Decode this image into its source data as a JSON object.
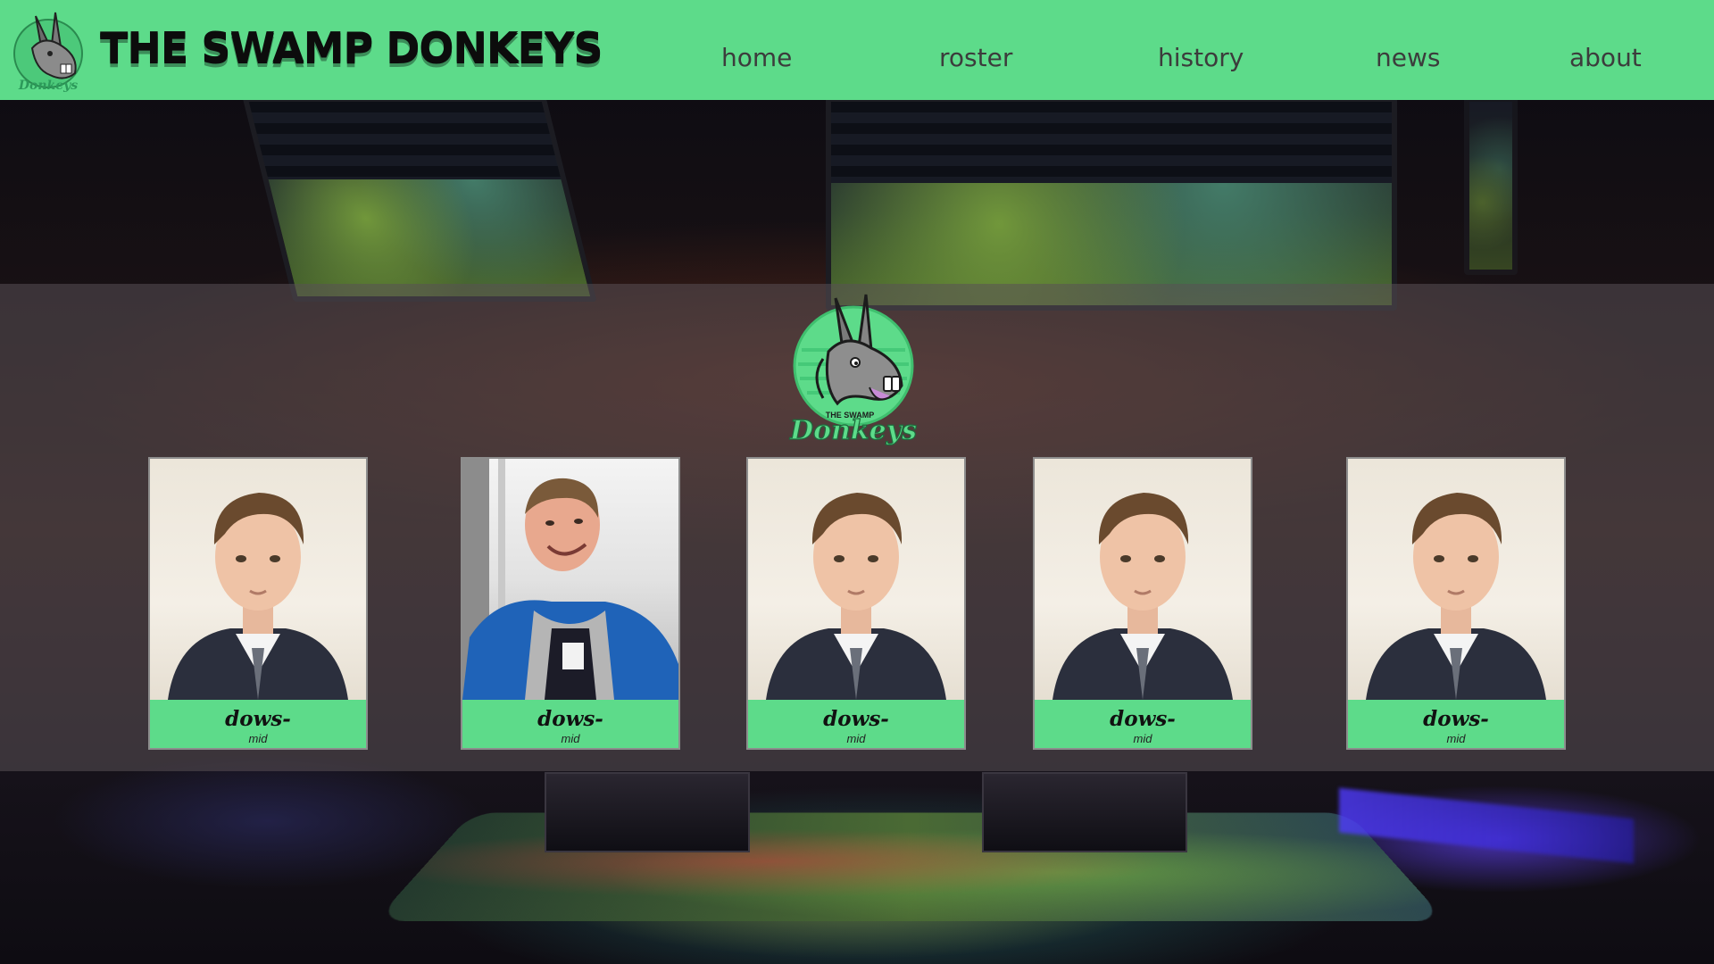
{
  "header": {
    "brand_title": "THE SWAMP DONKEYS",
    "logo_text": "Donkeys",
    "nav": [
      {
        "label": "home"
      },
      {
        "label": "roster"
      },
      {
        "label": "history"
      },
      {
        "label": "news"
      },
      {
        "label": "about"
      }
    ]
  },
  "roster": {
    "logo_top_text": "THE SWAMP",
    "logo_bottom_text": "Donkeys",
    "players": [
      {
        "name": "dows-",
        "role": "mid"
      },
      {
        "name": "dows-",
        "role": "mid"
      },
      {
        "name": "dows-",
        "role": "mid"
      },
      {
        "name": "dows-",
        "role": "mid"
      },
      {
        "name": "dows-",
        "role": "mid"
      }
    ]
  },
  "colors": {
    "accent_green": "#5ddb8a",
    "text_dark": "#111111",
    "band_overlay": "#5a5055"
  }
}
